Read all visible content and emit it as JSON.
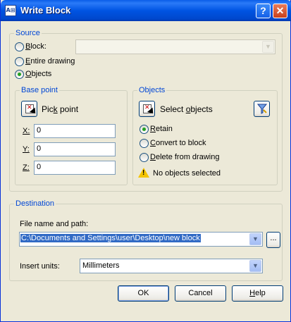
{
  "window": {
    "title": "Write Block",
    "app_icon": "autocad-icon"
  },
  "source": {
    "title": "Source",
    "options": [
      {
        "label": "Block:",
        "ul": "B",
        "rest": "lock:",
        "checked": false
      },
      {
        "label": "Entire drawing",
        "ul": "E",
        "rest": "ntire drawing",
        "checked": false
      },
      {
        "label": "Objects",
        "ul": "O",
        "rest": "bjects",
        "checked": true
      }
    ],
    "block_combo_value": ""
  },
  "base_point": {
    "title": "Base point",
    "pick_label_pre": "Pic",
    "pick_label_ul": "k",
    "pick_label_post": " point",
    "x_label": "X:",
    "x_value": "0",
    "y_label": "Y:",
    "y_value": "0",
    "z_label": "Z:",
    "z_value": "0"
  },
  "objects": {
    "title": "Objects",
    "select_label_pre": "Select ",
    "select_label_ul": "o",
    "select_label_post": "bjects",
    "options": [
      {
        "ul": "R",
        "rest": "etain",
        "checked": true
      },
      {
        "ul": "C",
        "rest": "onvert to block",
        "checked": false
      },
      {
        "ul": "D",
        "rest": "elete from drawing",
        "checked": false
      }
    ],
    "status": "No objects selected"
  },
  "destination": {
    "title": "Destination",
    "file_label": "File name and path:",
    "file_value": "C:\\Documents and Settings\\user\\Desktop\\new block",
    "browse_label": "...",
    "units_label": "Insert units:",
    "units_value": "Millimeters"
  },
  "buttons": {
    "ok": "OK",
    "cancel": "Cancel",
    "help_pre": "",
    "help_ul": "H",
    "help_post": "elp"
  }
}
